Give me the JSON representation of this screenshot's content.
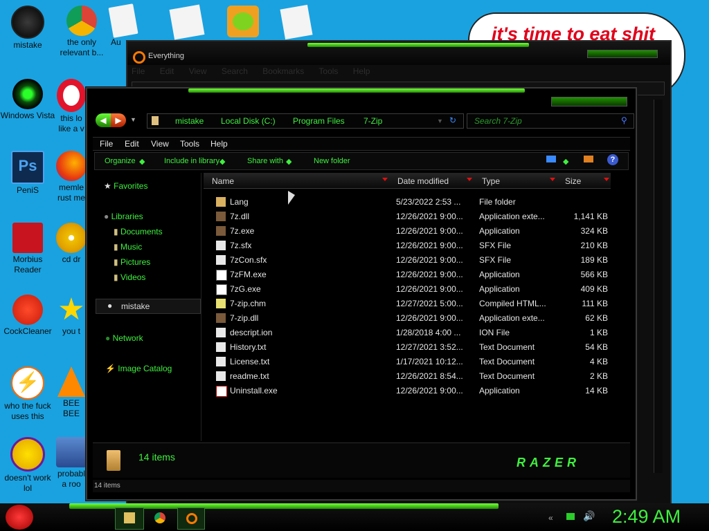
{
  "desktop": {
    "icons": [
      {
        "label": "mistake",
        "icon": "razer-orb-icon"
      },
      {
        "label": "the only relevant b...",
        "icon": "chrome-icon"
      },
      {
        "label": "Au",
        "icon": "document-icon"
      },
      {
        "label": "Windows Vista",
        "icon": "razer-orb-icon"
      },
      {
        "label": "this lo like a v",
        "icon": "opera-icon"
      },
      {
        "label": "PeniS",
        "icon": "photoshop-icon"
      },
      {
        "label": "memle rust me",
        "icon": "firefox-icon"
      },
      {
        "label": "Morbius Reader",
        "icon": "acrobat-icon"
      },
      {
        "label": "cd dr",
        "icon": "cd-icon"
      },
      {
        "label": "CockCleaner",
        "icon": "ccleaner-icon"
      },
      {
        "label": "you t",
        "icon": "star-icon"
      },
      {
        "label": "who the fuck uses this",
        "icon": "lightning-icon"
      },
      {
        "label": "BEE BEE",
        "icon": "vlc-icon"
      },
      {
        "label": "doesn't work lol",
        "icon": "yahoo-messenger-icon"
      },
      {
        "label": "probabl a roo",
        "icon": "installer-icon"
      }
    ],
    "bubble_text": "it's time to eat shit"
  },
  "everything_window": {
    "title": "Everything",
    "menu": [
      "File",
      "Edit",
      "View",
      "Search",
      "Bookmarks",
      "Tools",
      "Help"
    ]
  },
  "explorer": {
    "breadcrumb": [
      "mistake",
      "Local Disk (C:)",
      "Program Files",
      "7-Zip"
    ],
    "search_placeholder": "Search 7-Zip",
    "menu": [
      "File",
      "Edit",
      "View",
      "Tools",
      "Help"
    ],
    "commands": [
      "Organize",
      "Include in library",
      "Share with",
      "New folder"
    ],
    "nav": {
      "favorites": "Favorites",
      "libraries": "Libraries",
      "library_items": [
        "Documents",
        "Music",
        "Pictures",
        "Videos"
      ],
      "homegroup": "mistake",
      "network": "Network",
      "image_catalog": "Image Catalog"
    },
    "columns": [
      "Name",
      "Date modified",
      "Type",
      "Size"
    ],
    "files": [
      {
        "name": "Lang",
        "date": "5/23/2022 2:53 ...",
        "type": "File folder",
        "size": ""
      },
      {
        "name": "7z.dll",
        "date": "12/26/2021 9:00...",
        "type": "Application exte...",
        "size": "1,141 KB"
      },
      {
        "name": "7z.exe",
        "date": "12/26/2021 9:00...",
        "type": "Application",
        "size": "324 KB"
      },
      {
        "name": "7z.sfx",
        "date": "12/26/2021 9:00...",
        "type": "SFX File",
        "size": "210 KB"
      },
      {
        "name": "7zCon.sfx",
        "date": "12/26/2021 9:00...",
        "type": "SFX File",
        "size": "189 KB"
      },
      {
        "name": "7zFM.exe",
        "date": "12/26/2021 9:00...",
        "type": "Application",
        "size": "566 KB"
      },
      {
        "name": "7zG.exe",
        "date": "12/26/2021 9:00...",
        "type": "Application",
        "size": "409 KB"
      },
      {
        "name": "7-zip.chm",
        "date": "12/27/2021 5:00...",
        "type": "Compiled HTML...",
        "size": "111 KB"
      },
      {
        "name": "7-zip.dll",
        "date": "12/26/2021 9:00...",
        "type": "Application exte...",
        "size": "62 KB"
      },
      {
        "name": "descript.ion",
        "date": "1/28/2018 4:00 ...",
        "type": "ION File",
        "size": "1 KB"
      },
      {
        "name": "History.txt",
        "date": "12/27/2021 3:52...",
        "type": "Text Document",
        "size": "54 KB"
      },
      {
        "name": "License.txt",
        "date": "1/17/2021 10:12...",
        "type": "Text Document",
        "size": "4 KB"
      },
      {
        "name": "readme.txt",
        "date": "12/26/2021 8:54...",
        "type": "Text Document",
        "size": "2 KB"
      },
      {
        "name": "Uninstall.exe",
        "date": "12/26/2021 9:00...",
        "type": "Application",
        "size": "14 KB"
      }
    ],
    "details_count": "14 items",
    "status_count": "14 items",
    "brand": "RAZER"
  },
  "taskbar": {
    "clock": "2:49 AM"
  },
  "colors": {
    "accent_green": "#3ff03f",
    "desktop_blue": "#1aa2e0",
    "window_black": "#000000"
  }
}
